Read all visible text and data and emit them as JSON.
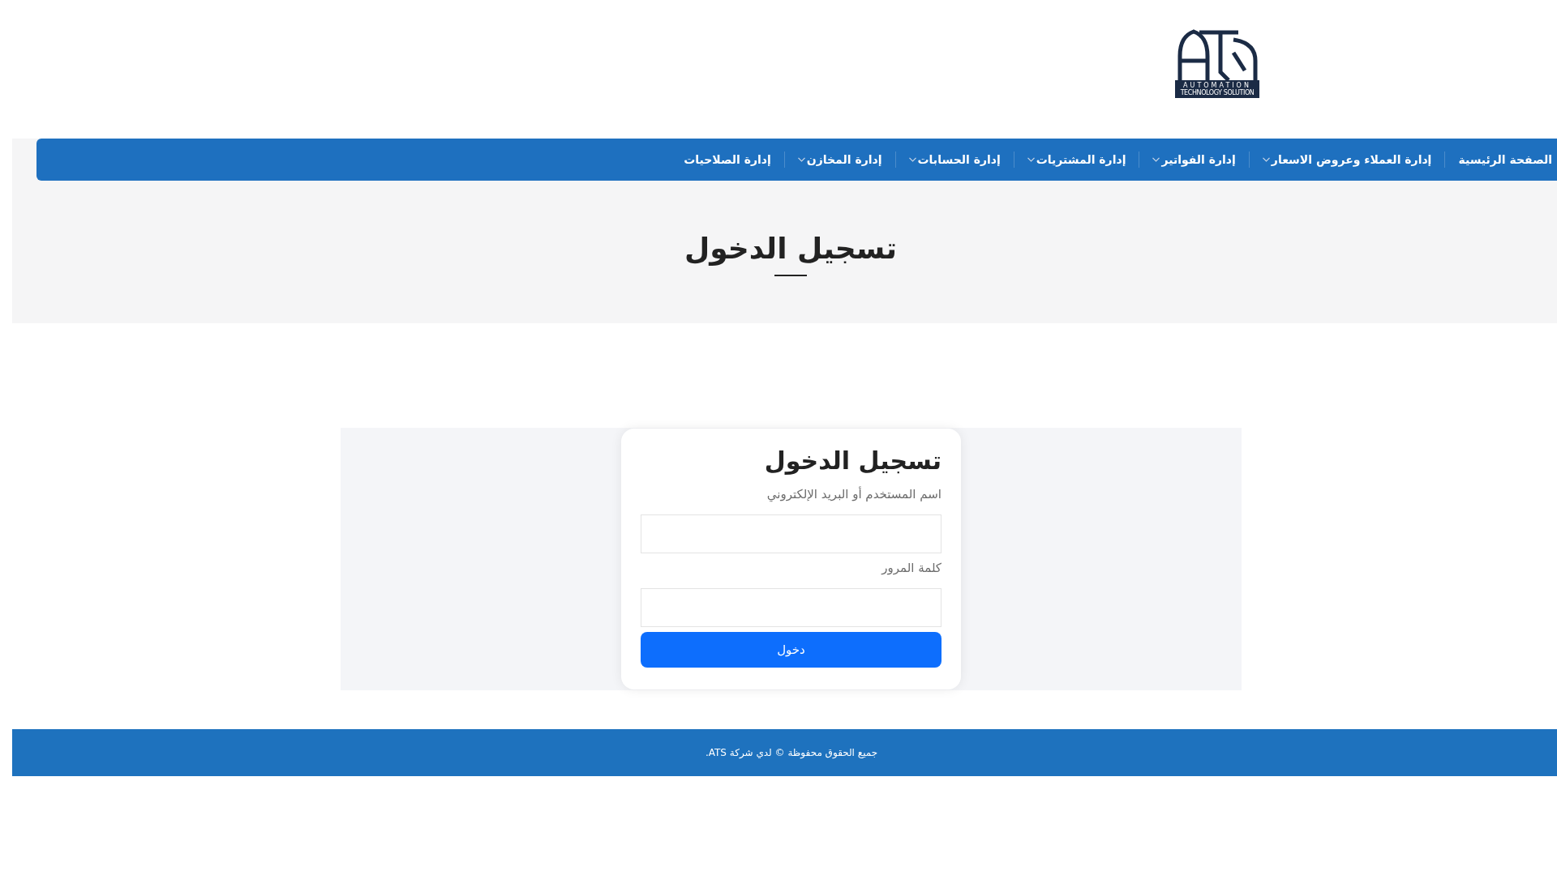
{
  "logo": {
    "line_1": "AUTOMATION",
    "line_2": "TECHNOLOGY SOLUTION"
  },
  "nav": {
    "items": [
      {
        "label": "الصفحة الرئيسية",
        "dropdown": false
      },
      {
        "label": "إدارة العملاء وعروض الاسعار",
        "dropdown": true
      },
      {
        "label": "إدارة الفواتير",
        "dropdown": true
      },
      {
        "label": "إدارة المشتريات",
        "dropdown": true
      },
      {
        "label": "إدارة الحسابات",
        "dropdown": true
      },
      {
        "label": "إدارة المخازن",
        "dropdown": true
      },
      {
        "label": "إدارة الصلاحيات",
        "dropdown": false
      }
    ]
  },
  "page_title": "تسجيل الدخول",
  "login_form": {
    "title": "تسجيل الدخول",
    "fields": [
      {
        "label": "اسم المستخدم أو البريد الإلكتروني"
      },
      {
        "label": "كلمة المرور"
      }
    ],
    "submit": "دخول"
  },
  "footer": {
    "text": "جميع الحقوق محفوظة © لدي شركة ATS."
  }
}
